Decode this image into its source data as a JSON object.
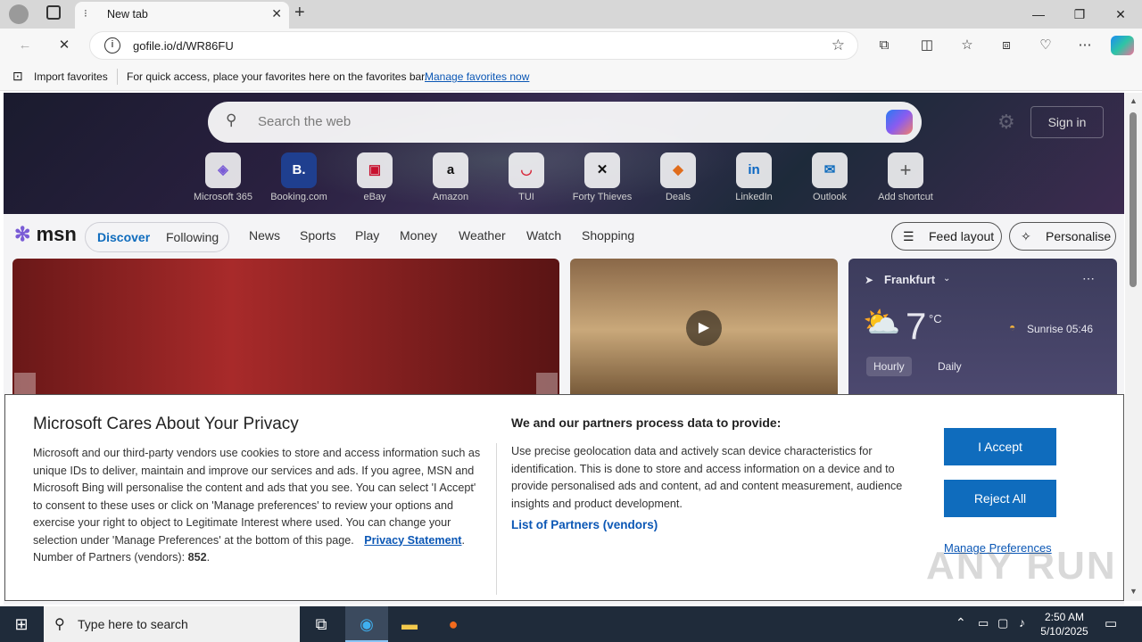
{
  "browser": {
    "tab_title": "New tab",
    "url": "gofile.io/d/WR86FU",
    "favorites_bar": {
      "import_label": "Import favorites",
      "hint": "For quick access, place your favorites here on the favorites bar.",
      "manage_link": "Manage favorites now"
    }
  },
  "msn": {
    "search_placeholder": "Search the web",
    "sign_in": "Sign in",
    "shortcuts": [
      "Microsoft 365",
      "Booking.com",
      "eBay",
      "Amazon",
      "TUI",
      "Forty Thieves",
      "Deals",
      "LinkedIn",
      "Outlook",
      "Add shortcut"
    ],
    "logo": "msn",
    "segment": [
      "Discover",
      "Following"
    ],
    "nav": [
      "News",
      "Sports",
      "Play",
      "Money",
      "Weather",
      "Watch",
      "Shopping"
    ],
    "feed_layout": "Feed layout",
    "personalise": "Personalise",
    "weather": {
      "location": "Frankfurt",
      "temp": "7",
      "unit": "°C",
      "sunrise": "Sunrise 05:46",
      "tabs": [
        "Hourly",
        "Daily"
      ]
    }
  },
  "privacy": {
    "title": "Microsoft Cares About Your Privacy",
    "body": "Microsoft and our third-party vendors use cookies to store and access information such as unique IDs to deliver, maintain and improve our services and ads. If you agree, MSN and Microsoft Bing will personalise the content and ads that you see. You can select 'I Accept' to consent to these uses or click on 'Manage preferences' to review your options and exercise your right to object to Legitimate Interest where used.  You can change your selection under 'Manage Preferences' at the bottom of this page.",
    "privacy_link": "Privacy Statement",
    "partners_label": "Number of Partners (vendors):",
    "partners_count": "852",
    "right_title": "We and our partners process data to provide:",
    "right_body": "Use precise geolocation data and actively scan device characteristics for identification. This is done to store and access information on a device and to provide personalised ads and content, ad and content measurement, audience insights and product development.",
    "vendors_link": "List of Partners (vendors)",
    "accept": "I Accept",
    "reject": "Reject All",
    "manage": "Manage Preferences"
  },
  "taskbar": {
    "search_placeholder": "Type here to search",
    "time": "2:50 AM",
    "date": "5/10/2025"
  },
  "watermark": "ANY RUN"
}
